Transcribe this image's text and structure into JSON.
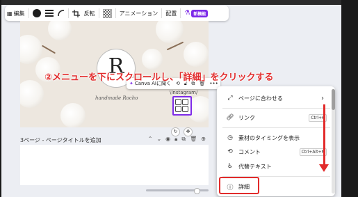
{
  "toolbar": {
    "edit_label": "編集",
    "flip_label": "反転",
    "animation_label": "アニメーション",
    "position_label": "配置",
    "new_badge": "新機能"
  },
  "design": {
    "logo_letter": "R",
    "brand_name": "handmade Rocho",
    "instagram_label": "\\Instagram/"
  },
  "context_toolbar": {
    "ai_label": "Canva AIに聞く",
    "more_label": "•••"
  },
  "annotation": {
    "text": "②メニューを下にスクロールし、「詳細」をクリックする",
    "color": "#e22b2b"
  },
  "page": {
    "title": "3ページ - ページタイトルを追加"
  },
  "menu": {
    "items": [
      {
        "icon": "expand-icon",
        "label": "ページに合わせる",
        "shortcut": "",
        "chevron": "›"
      },
      {
        "icon": "link-icon",
        "label": "リンク",
        "shortcut": "Ctrl+K"
      },
      {
        "icon": "timing-icon",
        "label": "素材のタイミングを表示",
        "shortcut": ""
      },
      {
        "icon": "comment-icon",
        "label": "コメント",
        "shortcut": "Ctrl+Alt+N"
      },
      {
        "icon": "accessibility-icon",
        "label": "代替テキスト",
        "shortcut": ""
      },
      {
        "icon": "info-icon",
        "label": "詳細",
        "shortcut": ""
      }
    ]
  },
  "colors": {
    "accent": "#7d2ae8",
    "annotation": "#e22b2b"
  }
}
